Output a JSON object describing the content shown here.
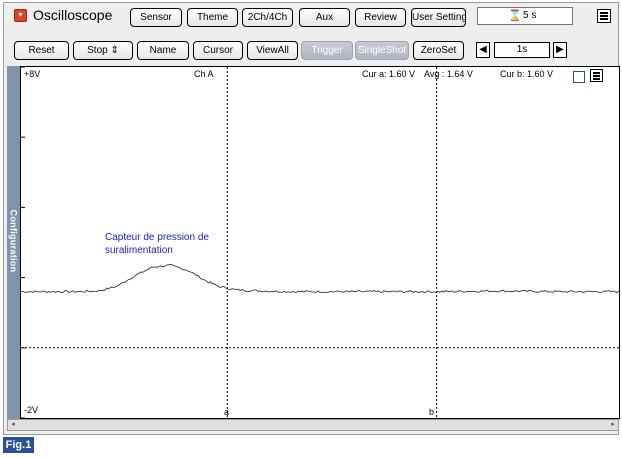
{
  "app": {
    "title": "Oscilloscope"
  },
  "toolbar_top": {
    "sensor": "Sensor",
    "theme": "Theme",
    "channels": "2Ch/4Ch",
    "aux": "Aux",
    "review": "Review",
    "user_setting": "User Setting",
    "timer_value": "5 s"
  },
  "toolbar_bottom": {
    "reset": "Reset",
    "stop": "Stop",
    "stop_arrows": "⇕",
    "name": "Name",
    "cursor": "Cursor",
    "viewall": "ViewAll",
    "trigger": "Trigger",
    "singleshot": "SingleShot",
    "zeroset": "ZeroSet",
    "timebase": "1s"
  },
  "sidebar": {
    "label": "Configuration"
  },
  "scope": {
    "ymax": "+8V",
    "ymin": "-2V",
    "channel": "Ch A",
    "cur_a": "Cur a: 1.60 V",
    "avg": "Avg : 1.64 V",
    "cur_b": "Cur b: 1.60 V",
    "cursor_a": "a",
    "cursor_b": "b",
    "annotation": "Capteur de pression de suralimentation"
  },
  "figure_label": "Fig.1",
  "colors": {
    "sidebar": "#7f93aa",
    "annotation": "#1a1acc",
    "fig_badge": "#2a4f9b",
    "app_icon": "#d9472b"
  },
  "chart_data": {
    "type": "line",
    "ylim": [
      -2,
      8
    ],
    "series": [
      {
        "name": "Ch A",
        "x": [
          0,
          0.5,
          1.0,
          1.3,
          1.6,
          1.9,
          2.2,
          2.5,
          2.8,
          3.1,
          3.3,
          3.6,
          4.0,
          4.5,
          5.0,
          6.0,
          7.0,
          8.0,
          9.0,
          10.0
        ],
        "values": [
          1.6,
          1.6,
          1.6,
          1.62,
          1.75,
          2.05,
          2.3,
          2.35,
          2.2,
          1.9,
          1.75,
          1.65,
          1.62,
          1.6,
          1.6,
          1.6,
          1.6,
          1.62,
          1.6,
          1.6
        ]
      }
    ]
  }
}
